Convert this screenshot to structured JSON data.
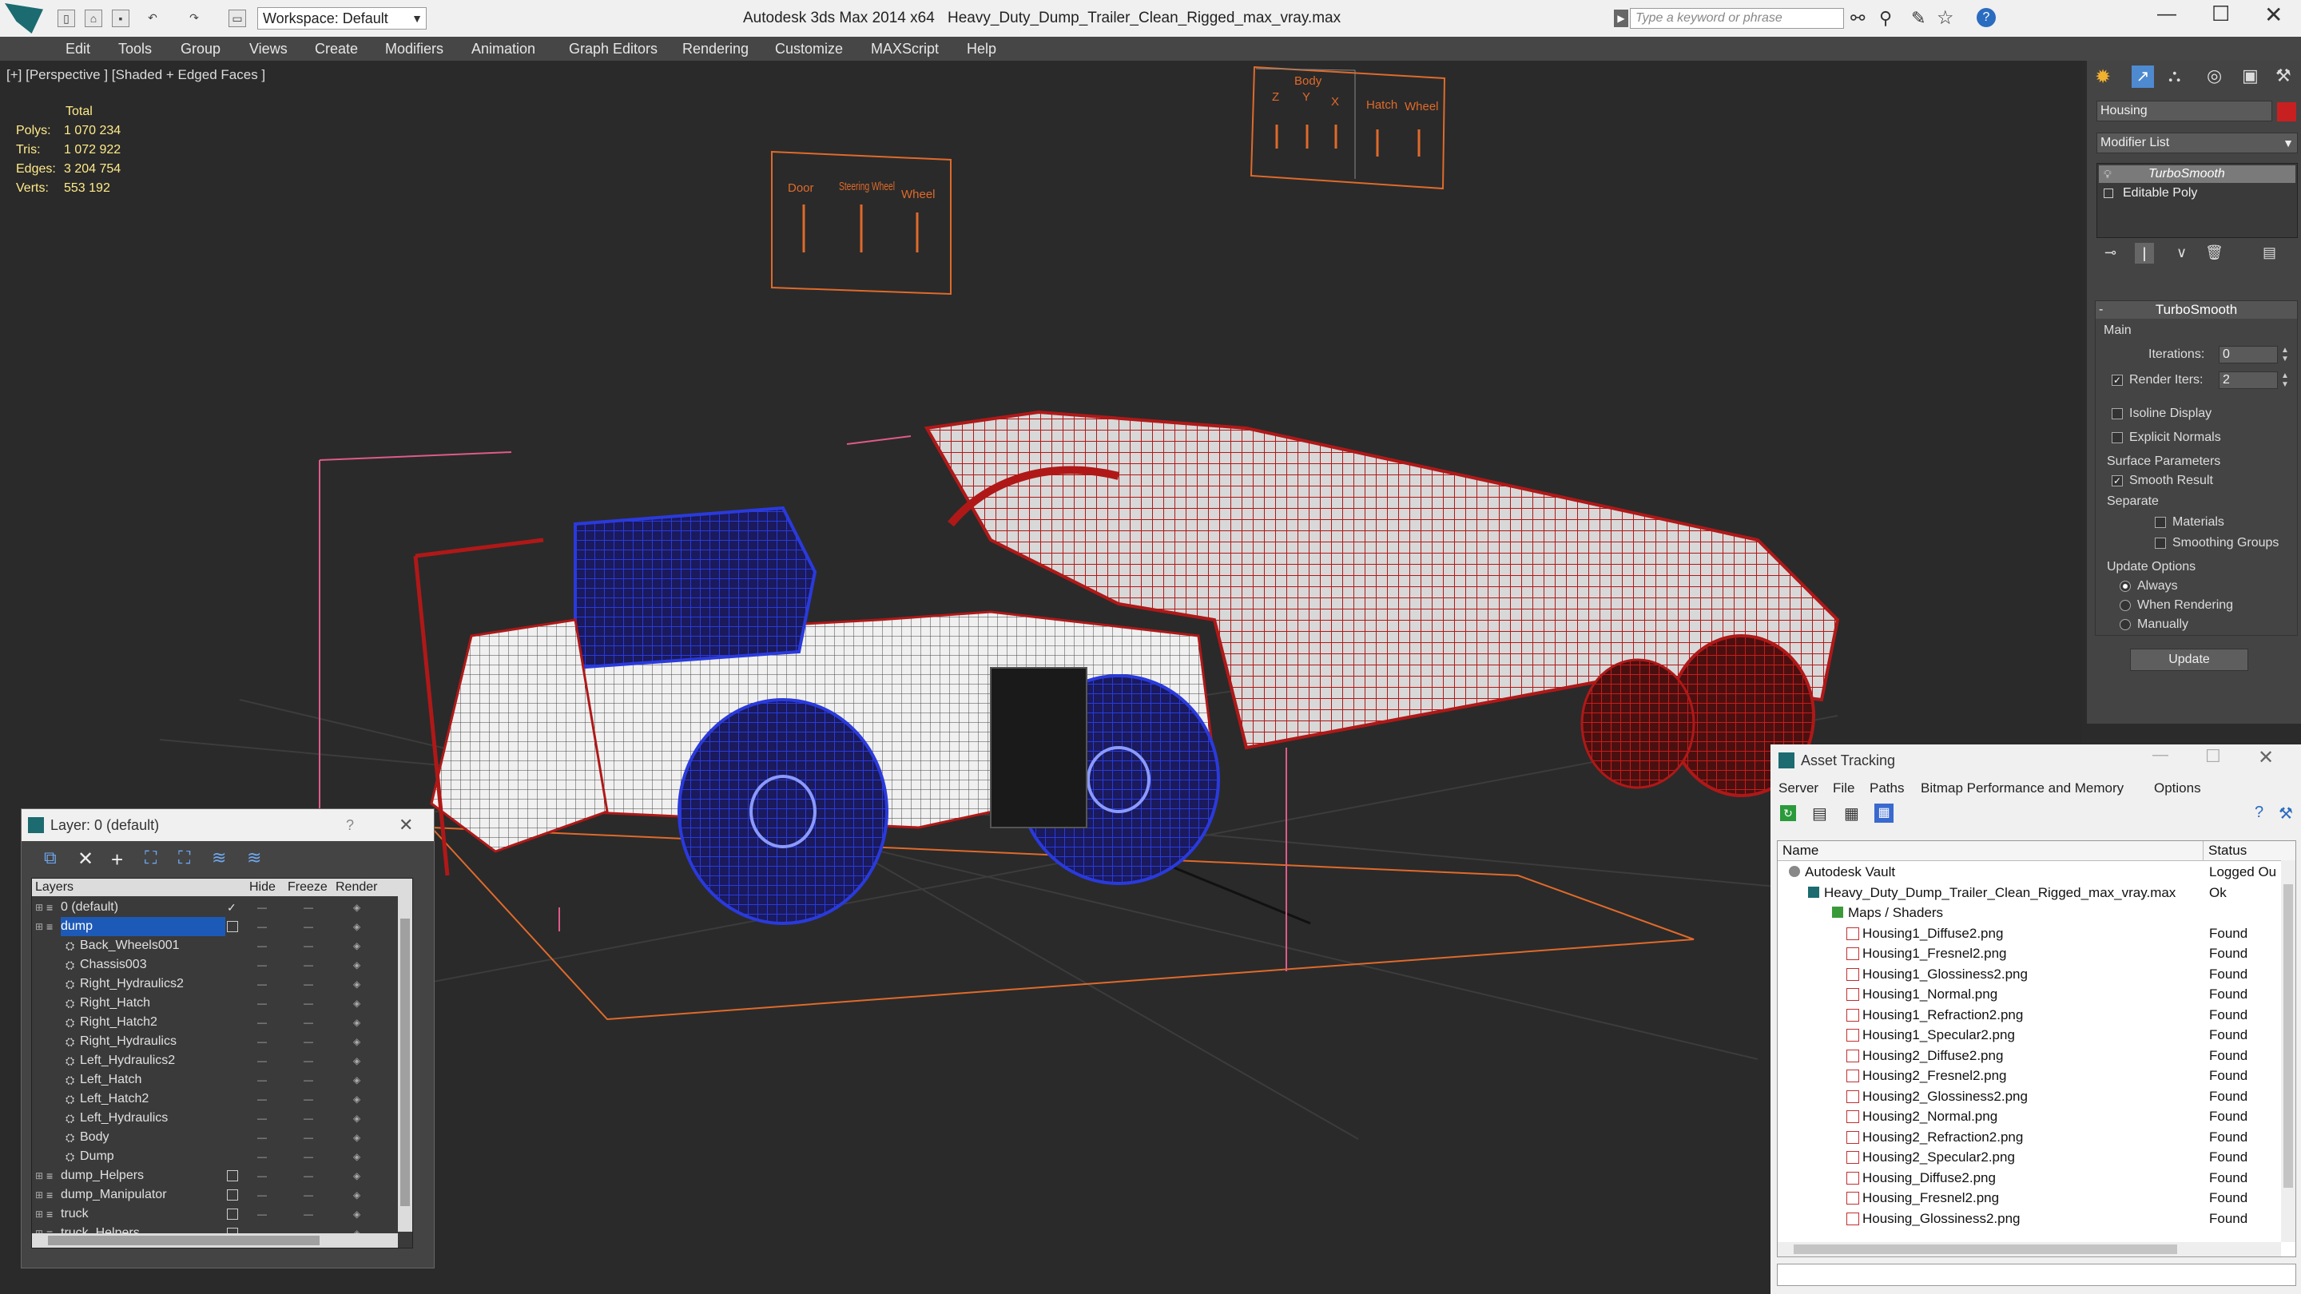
{
  "titlebar": {
    "workspace": "Workspace: Default",
    "app_title": "Autodesk 3ds Max  2014 x64",
    "file_title": "Heavy_Duty_Dump_Trailer_Clean_Rigged_max_vray.max",
    "search_placeholder": "Type a keyword or phrase"
  },
  "menu": [
    "Edit",
    "Tools",
    "Group",
    "Views",
    "Create",
    "Modifiers",
    "Animation",
    "Graph Editors",
    "Rendering",
    "Customize",
    "MAXScript",
    "Help"
  ],
  "viewport": {
    "label": "[+] [Perspective ] [Shaded + Edged Faces ]",
    "stats": {
      "header": "Total",
      "polys_label": "Polys:",
      "polys": "1 070 234",
      "tris_label": "Tris:",
      "tris": "1 072 922",
      "edges_label": "Edges:",
      "edges": "3 204 754",
      "verts_label": "Verts:",
      "verts": "553 192"
    },
    "gizmo_left": {
      "labels": [
        "Door",
        "Steering Wheel",
        "Wheel"
      ]
    },
    "gizmo_right": {
      "title": "Body",
      "labels": [
        "Z",
        "Y",
        "X",
        "Hatch",
        "Wheel"
      ]
    }
  },
  "command_panel": {
    "object_name": "Housing",
    "modifier_list": "Modifier List",
    "stack": [
      "TurboSmooth",
      "Editable Poly"
    ],
    "rollout_title": "TurboSmooth",
    "main_label": "Main",
    "iterations_label": "Iterations:",
    "iterations": "0",
    "render_iters_label": "Render Iters:",
    "render_iters": "2",
    "isoline": "Isoline Display",
    "explicit_normals": "Explicit Normals",
    "surface_params": "Surface Parameters",
    "smooth_result": "Smooth Result",
    "separate": "Separate",
    "materials": "Materials",
    "smoothing_groups": "Smoothing Groups",
    "update_options": "Update Options",
    "always": "Always",
    "when_rendering": "When Rendering",
    "manually": "Manually",
    "update_button": "Update"
  },
  "layer_window": {
    "title": "Layer: 0 (default)",
    "help": "?",
    "columns": [
      "Layers",
      "Hide",
      "Freeze",
      "Render"
    ],
    "rows": [
      {
        "name": "0 (default)",
        "indent": 1
      },
      {
        "name": "dump",
        "indent": 1,
        "selected": true
      },
      {
        "name": "Back_Wheels001",
        "indent": 2
      },
      {
        "name": "Chassis003",
        "indent": 2
      },
      {
        "name": "Right_Hydraulics2",
        "indent": 2
      },
      {
        "name": "Right_Hatch",
        "indent": 2
      },
      {
        "name": "Right_Hatch2",
        "indent": 2
      },
      {
        "name": "Right_Hydraulics",
        "indent": 2
      },
      {
        "name": "Left_Hydraulics2",
        "indent": 2
      },
      {
        "name": "Left_Hatch",
        "indent": 2
      },
      {
        "name": "Left_Hatch2",
        "indent": 2
      },
      {
        "name": "Left_Hydraulics",
        "indent": 2
      },
      {
        "name": "Body",
        "indent": 2
      },
      {
        "name": "Dump",
        "indent": 2
      },
      {
        "name": "dump_Helpers",
        "indent": 1
      },
      {
        "name": "dump_Manipulator",
        "indent": 1
      },
      {
        "name": "truck",
        "indent": 1
      },
      {
        "name": "truck_Helpers",
        "indent": 1
      }
    ]
  },
  "asset_tracking": {
    "title": "Asset Tracking",
    "menu": [
      "Server",
      "File",
      "Paths",
      "Bitmap Performance and Memory",
      "Options"
    ],
    "columns": [
      "Name",
      "Status"
    ],
    "rows": [
      {
        "name": "Autodesk Vault",
        "status": "Logged Ou",
        "indent": 0
      },
      {
        "name": "Heavy_Duty_Dump_Trailer_Clean_Rigged_max_vray.max",
        "status": "Ok",
        "indent": 1
      },
      {
        "name": "Maps / Shaders",
        "status": "",
        "indent": 2
      },
      {
        "name": "Housing1_Diffuse2.png",
        "status": "Found",
        "indent": 3
      },
      {
        "name": "Housing1_Fresnel2.png",
        "status": "Found",
        "indent": 3
      },
      {
        "name": "Housing1_Glossiness2.png",
        "status": "Found",
        "indent": 3
      },
      {
        "name": "Housing1_Normal.png",
        "status": "Found",
        "indent": 3
      },
      {
        "name": "Housing1_Refraction2.png",
        "status": "Found",
        "indent": 3
      },
      {
        "name": "Housing1_Specular2.png",
        "status": "Found",
        "indent": 3
      },
      {
        "name": "Housing2_Diffuse2.png",
        "status": "Found",
        "indent": 3
      },
      {
        "name": "Housing2_Fresnel2.png",
        "status": "Found",
        "indent": 3
      },
      {
        "name": "Housing2_Glossiness2.png",
        "status": "Found",
        "indent": 3
      },
      {
        "name": "Housing2_Normal.png",
        "status": "Found",
        "indent": 3
      },
      {
        "name": "Housing2_Refraction2.png",
        "status": "Found",
        "indent": 3
      },
      {
        "name": "Housing2_Specular2.png",
        "status": "Found",
        "indent": 3
      },
      {
        "name": "Housing_Diffuse2.png",
        "status": "Found",
        "indent": 3
      },
      {
        "name": "Housing_Fresnel2.png",
        "status": "Found",
        "indent": 3
      },
      {
        "name": "Housing_Glossiness2.png",
        "status": "Found",
        "indent": 3
      }
    ]
  },
  "colors": {
    "accent_orange": "#e06a2a",
    "wire_red": "#b01818",
    "wire_blue": "#2030c0",
    "selection": "#1d5ab8",
    "stats_yellow": "#ffeb8a"
  }
}
